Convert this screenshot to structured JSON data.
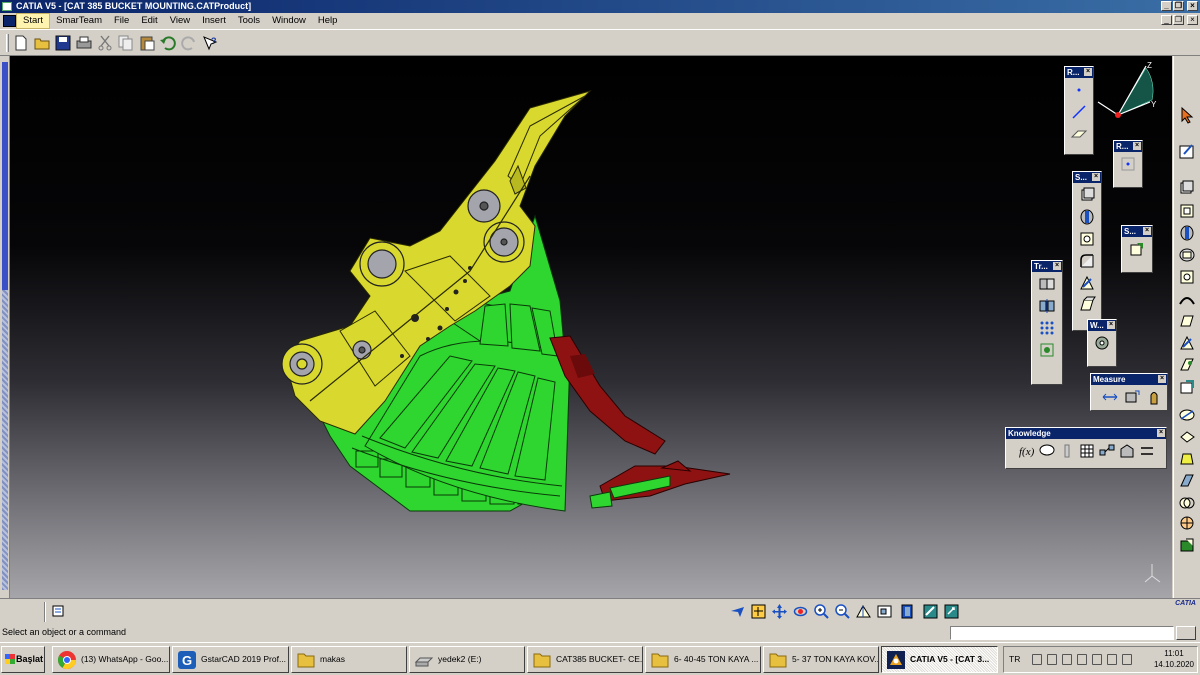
{
  "window": {
    "title": "CATIA V5 - [CAT 385 BUCKET MOUNTING.CATProduct]",
    "buttons": [
      "minimize",
      "restore",
      "close"
    ]
  },
  "menu": {
    "items": [
      {
        "label": "Start",
        "active": true
      },
      {
        "label": "SmarTeam"
      },
      {
        "label": "File"
      },
      {
        "label": "Edit"
      },
      {
        "label": "View"
      },
      {
        "label": "Insert"
      },
      {
        "label": "Tools"
      },
      {
        "label": "Window"
      },
      {
        "label": "Help"
      }
    ]
  },
  "toolbar": {
    "icons": [
      "new-icon",
      "open-icon",
      "save-icon",
      "print-icon",
      "cut-icon",
      "copy-icon",
      "paste-icon",
      "undo-icon",
      "redo-icon",
      "whats-this-icon"
    ]
  },
  "floating_toolbars": {
    "r1": {
      "title": "R..."
    },
    "r2": {
      "title": "R..."
    },
    "s1": {
      "title": "S..."
    },
    "s2": {
      "title": "S..."
    },
    "tr": {
      "title": "Tr..."
    },
    "w": {
      "title": "W..."
    },
    "measure": {
      "title": "Measure"
    },
    "knowledge": {
      "title": "Knowledge"
    }
  },
  "compass": {
    "axes": [
      "Z",
      "Y"
    ]
  },
  "model": {
    "colors": {
      "yellow": "#d8d82e",
      "green": "#2fd62f",
      "red": "#8e1212",
      "gray": "#a4a4ac"
    }
  },
  "bottom_toolbar": {
    "icons": [
      "fly-mode-icon",
      "fit-all-icon",
      "pan-icon",
      "rotate-icon",
      "zoom-in-icon",
      "zoom-out-icon",
      "normal-view-icon",
      "multi-view-icon",
      "view-mode-icon",
      "hide-show-icon",
      "swap-space-icon"
    ],
    "logo": "CATIA"
  },
  "status": {
    "text": "Select an object or a command",
    "command_value": ""
  },
  "taskbar": {
    "start_label": "Başlat",
    "tasks": [
      {
        "label": "(13) WhatsApp - Goo...",
        "icon": "chrome-icon"
      },
      {
        "label": "GstarCAD 2019 Prof...",
        "icon": "gstarcad-icon"
      },
      {
        "label": "makas",
        "icon": "folder-icon"
      },
      {
        "label": "yedek2 (E:)",
        "icon": "drive-icon"
      },
      {
        "label": "CAT385 BUCKET- CE...",
        "icon": "folder-icon"
      },
      {
        "label": "6- 40-45 TON KAYA ...",
        "icon": "folder-icon"
      },
      {
        "label": "5- 37 TON KAYA KOV...",
        "icon": "folder-icon"
      },
      {
        "label": "CATIA V5 - [CAT 3...",
        "icon": "catia-icon",
        "active": true
      }
    ],
    "tray": {
      "language": "TR",
      "time": "11:01",
      "date": "14.10.2020"
    }
  }
}
